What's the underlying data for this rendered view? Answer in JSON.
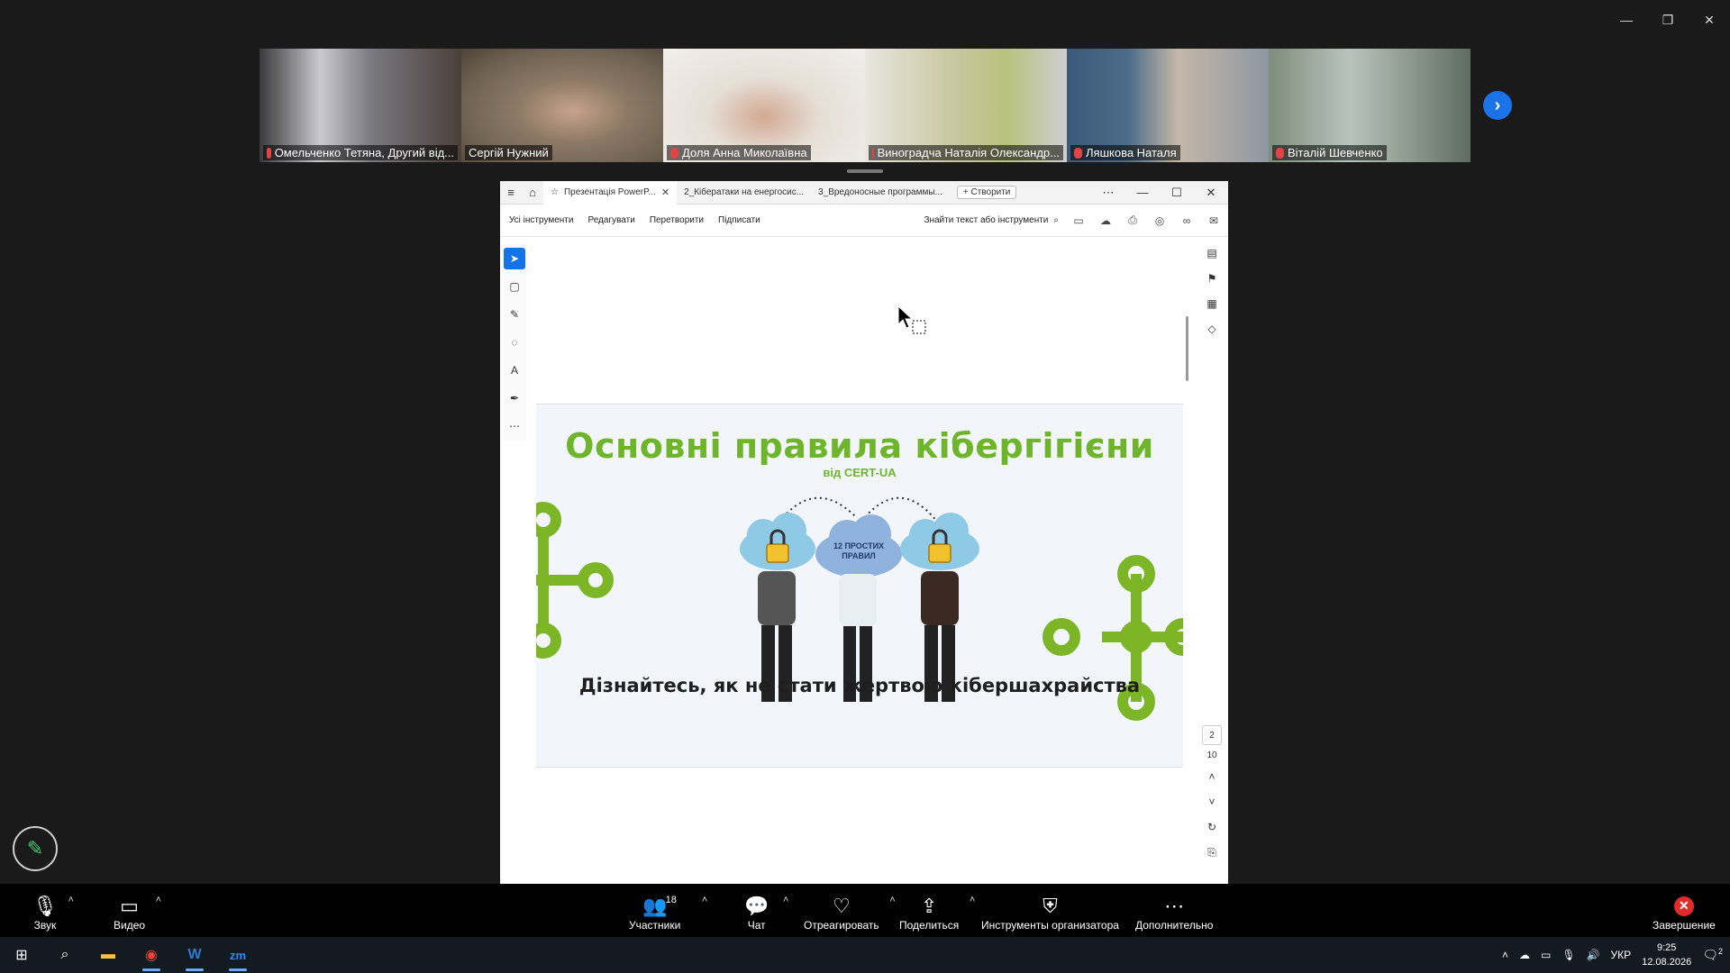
{
  "window": {
    "minimize": "—",
    "restore": "❐",
    "close": "✕"
  },
  "participants_strip": [
    {
      "name": "Омельченко Тетяна, Другий від...",
      "muted": true,
      "bg": "#5d5d60"
    },
    {
      "name": "Сергій Нужний",
      "muted": false,
      "bg": "#8a7a66",
      "active": true
    },
    {
      "name": "Доля Анна Миколаївна",
      "muted": true,
      "bg": "#d9d6d2"
    },
    {
      "name": "Виноградча Наталія Олександр...",
      "muted": true,
      "bg": "#c5c8a3"
    },
    {
      "name": "Ляшкова Наталя",
      "muted": true,
      "bg": "#8d8d84"
    },
    {
      "name": "Віталій Шевченко",
      "muted": true,
      "bg": "#9ba89f"
    }
  ],
  "acrobat": {
    "tabs": [
      {
        "label": "Презентація PowerP...",
        "active": true
      },
      {
        "label": "2_Кібератаки на енергосис...",
        "active": false
      },
      {
        "label": "3_Вредоносные программы...",
        "active": false
      }
    ],
    "create_label": "Створити",
    "menu": [
      "Усі інструменти",
      "Редагувати",
      "Перетворити",
      "Підписати"
    ],
    "find_label": "Знайти текст або інструменти",
    "page_current": "2",
    "page_total": "10",
    "slide": {
      "title": "Основні правила кібергігієни",
      "subtitle": "від CERT-UA",
      "cloud_label_line1": "12 ПРОСТИХ",
      "cloud_label_line2": "ПРАВИЛ",
      "tagline": "Дізнайтесь, як не стати жертвою кібершахрайства",
      "accent_color": "#6fb52c"
    }
  },
  "controls": {
    "audio": "Звук",
    "video": "Видео",
    "participants": "Участники",
    "participants_count": "18",
    "chat": "Чат",
    "react": "Отреагировать",
    "share": "Поделиться",
    "host_tools": "Инструменты организатора",
    "more": "Дополнительно",
    "end": "Завершение"
  },
  "taskbar": {
    "language": "УКР",
    "time": "9:25",
    "date": "12.08.2026",
    "notifications": "2"
  }
}
